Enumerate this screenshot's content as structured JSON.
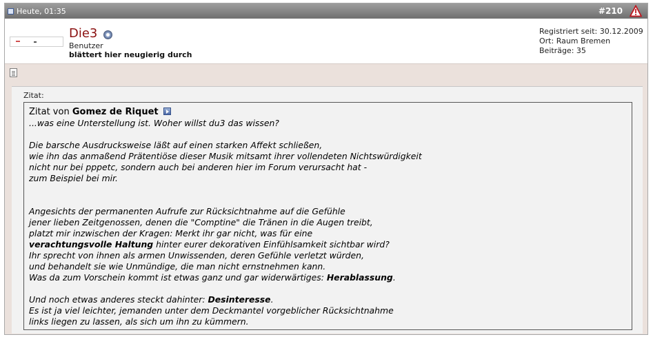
{
  "header": {
    "date": "Heute, 01:35",
    "post_number": "#210"
  },
  "user": {
    "name": "Die3",
    "title": "Benutzer",
    "rank": "blättert hier neugierig durch",
    "registered": "Registriert seit: 30.12.2009",
    "location": "Ort: Raum Bremen",
    "posts": "Beiträge: 35"
  },
  "quote": {
    "label": "Zitat:",
    "intro": "Zitat von",
    "author": "Gomez de Riquet",
    "line1": "...was eine Unterstellung ist. Woher willst du3 das wissen?",
    "p2": [
      "Die barsche Ausdrucksweise läßt auf einen starken Affekt schließen,",
      "wie ihn das anmaßend Prätentiöse dieser Musik mitsamt ihrer vollendeten Nichtswürdigkeit",
      "nicht nur bei pppetc, sondern auch bei anderen hier im Forum verursacht hat -",
      "zum Beispiel bei mir."
    ],
    "p3_l1": "Angesichts der permanenten Aufrufe zur Rücksichtnahme auf die Gefühle",
    "p3_l2": "jener lieben Zeitgenossen, denen die \"Comptine\" die Tränen in die Augen treibt,",
    "p3_l3": "platzt mir inzwischen der Kragen: Merkt ihr gar nicht, was für eine",
    "p3_l4_bold": "verachtungsvolle Haltung",
    "p3_l4_rest": " hinter eurer dekorativen Einfühlsamkeit sichtbar wird?",
    "p3_l5": "Ihr sprecht von ihnen als armen Unwissenden, deren Gefühle verletzt würden,",
    "p3_l6": "und behandelt sie wie Unmündige, die man nicht ernstnehmen kann.",
    "p3_l7_pre": "Was da zum Vorschein kommt ist etwas ganz und gar widerwärtiges: ",
    "p3_l7_bold": "Herablassung",
    "p3_l7_post": ".",
    "p4_l1_pre": "Und noch etwas anderes steckt dahinter: ",
    "p4_l1_bold": "Desinteresse",
    "p4_l1_post": ".",
    "p4_l2": "Es ist ja viel leichter, jemanden unter dem Deckmantel vorgeblicher Rücksichtnahme",
    "p4_l3": "links liegen zu lassen, als sich um ihn zu kümmern."
  }
}
